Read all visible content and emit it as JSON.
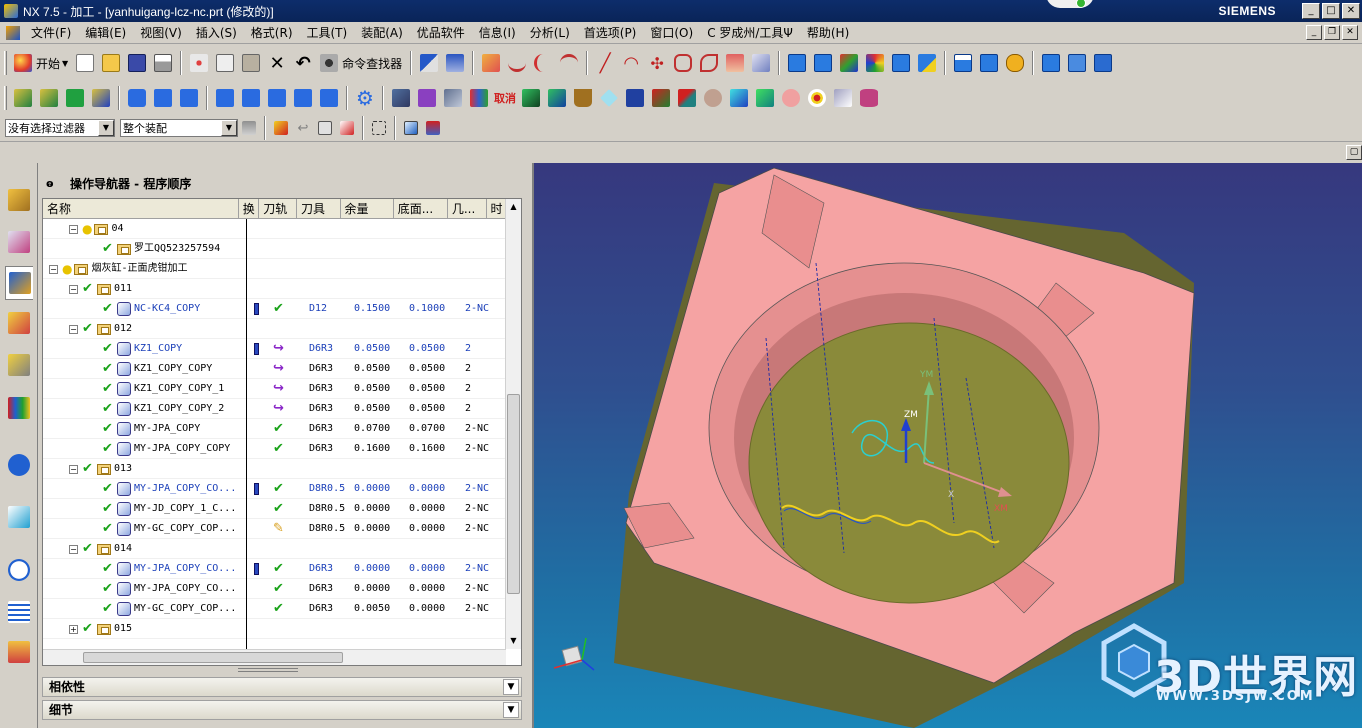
{
  "window": {
    "title": "NX 7.5 - 加工 - [yanhuigang-lcz-nc.prt (修改的)]",
    "brand": "SIEMENS",
    "controls": [
      "_",
      "□",
      "✕"
    ]
  },
  "menubar": {
    "items": [
      "文件(F)",
      "编辑(E)",
      "视图(V)",
      "插入(S)",
      "格式(R)",
      "工具(T)",
      "装配(A)",
      "优品软件",
      "信息(I)",
      "分析(L)",
      "首选项(P)",
      "窗口(O)",
      "C 罗成州/工具Ψ",
      "帮助(H)"
    ]
  },
  "toolbar": {
    "start_label": "开始",
    "finder_label": "命令查找器",
    "filter_select": "没有选择过滤器",
    "assembly_select": "整个装配"
  },
  "navigator": {
    "title": "操作导航器 - 程序顺序",
    "columns": [
      "名称",
      "换",
      "刀轨",
      "刀具",
      "余量",
      "底面...",
      "几...",
      "时"
    ],
    "rows": [
      {
        "indent": 1,
        "expander": "−",
        "bulb": true,
        "check": false,
        "icon": "folder",
        "name": "04",
        "lock": false,
        "status": "",
        "tool": "",
        "stock": "",
        "floor": "",
        "geom": "",
        "blue": false
      },
      {
        "indent": 2,
        "expander": "",
        "bulb": false,
        "check": true,
        "icon": "folder",
        "name": "罗工QQ523257594",
        "lock": false,
        "status": "",
        "tool": "",
        "stock": "",
        "floor": "",
        "geom": "",
        "blue": false
      },
      {
        "indent": 0,
        "expander": "−",
        "bulb": true,
        "check": false,
        "icon": "folder",
        "name": "烟灰缸-正面虎钳加工",
        "lock": false,
        "status": "",
        "tool": "",
        "stock": "",
        "floor": "",
        "geom": "",
        "blue": false
      },
      {
        "indent": 1,
        "expander": "−",
        "bulb": false,
        "check": true,
        "icon": "folder",
        "name": "011",
        "lock": false,
        "status": "",
        "tool": "",
        "stock": "",
        "floor": "",
        "geom": "",
        "blue": false
      },
      {
        "indent": 2,
        "expander": "",
        "bulb": false,
        "check": true,
        "icon": "op",
        "name": "NC-KC4_COPY",
        "lock": true,
        "status": "ok",
        "tool": "D12",
        "stock": "0.1500",
        "floor": "0.1000",
        "geom": "2-NC",
        "blue": true
      },
      {
        "indent": 1,
        "expander": "−",
        "bulb": false,
        "check": true,
        "icon": "folder",
        "name": "012",
        "lock": false,
        "status": "",
        "tool": "",
        "stock": "",
        "floor": "",
        "geom": "",
        "blue": false
      },
      {
        "indent": 2,
        "expander": "",
        "bulb": false,
        "check": true,
        "icon": "op",
        "name": "KZ1_COPY",
        "lock": true,
        "status": "regen",
        "tool": "D6R3",
        "stock": "0.0500",
        "floor": "0.0500",
        "geom": "2",
        "blue": true
      },
      {
        "indent": 2,
        "expander": "",
        "bulb": false,
        "check": true,
        "icon": "op",
        "name": "KZ1_COPY_COPY",
        "lock": false,
        "status": "regen",
        "tool": "D6R3",
        "stock": "0.0500",
        "floor": "0.0500",
        "geom": "2",
        "blue": false
      },
      {
        "indent": 2,
        "expander": "",
        "bulb": false,
        "check": true,
        "icon": "op",
        "name": "KZ1_COPY_COPY_1",
        "lock": false,
        "status": "regen",
        "tool": "D6R3",
        "stock": "0.0500",
        "floor": "0.0500",
        "geom": "2",
        "blue": false
      },
      {
        "indent": 2,
        "expander": "",
        "bulb": false,
        "check": true,
        "icon": "op",
        "name": "KZ1_COPY_COPY_2",
        "lock": false,
        "status": "regen",
        "tool": "D6R3",
        "stock": "0.0500",
        "floor": "0.0500",
        "geom": "2",
        "blue": false
      },
      {
        "indent": 2,
        "expander": "",
        "bulb": false,
        "check": true,
        "icon": "op",
        "name": "MY-JPA_COPY",
        "lock": false,
        "status": "ok",
        "tool": "D6R3",
        "stock": "0.0700",
        "floor": "0.0700",
        "geom": "2-NC",
        "blue": false
      },
      {
        "indent": 2,
        "expander": "",
        "bulb": false,
        "check": true,
        "icon": "op",
        "name": "MY-JPA_COPY_COPY",
        "lock": false,
        "status": "ok",
        "tool": "D6R3",
        "stock": "0.1600",
        "floor": "0.1600",
        "geom": "2-NC",
        "blue": false
      },
      {
        "indent": 1,
        "expander": "−",
        "bulb": false,
        "check": true,
        "icon": "folder",
        "name": "013",
        "lock": false,
        "status": "",
        "tool": "",
        "stock": "",
        "floor": "",
        "geom": "",
        "blue": false
      },
      {
        "indent": 2,
        "expander": "",
        "bulb": false,
        "check": true,
        "icon": "op",
        "name": "MY-JPA_COPY_CO...",
        "lock": true,
        "status": "ok",
        "tool": "D8R0.5",
        "stock": "0.0000",
        "floor": "0.0000",
        "geom": "2-NC",
        "blue": true
      },
      {
        "indent": 2,
        "expander": "",
        "bulb": false,
        "check": true,
        "icon": "op",
        "name": "MY-JD_COPY_1_C...",
        "lock": false,
        "status": "ok",
        "tool": "D8R0.5",
        "stock": "0.0000",
        "floor": "0.0000",
        "geom": "2-NC",
        "blue": false
      },
      {
        "indent": 2,
        "expander": "",
        "bulb": false,
        "check": true,
        "icon": "op",
        "name": "MY-GC_COPY_COP...",
        "lock": false,
        "status": "wrench",
        "tool": "D8R0.5",
        "stock": "0.0000",
        "floor": "0.0000",
        "geom": "2-NC",
        "blue": false
      },
      {
        "indent": 1,
        "expander": "−",
        "bulb": false,
        "check": true,
        "icon": "folder",
        "name": "014",
        "lock": false,
        "status": "",
        "tool": "",
        "stock": "",
        "floor": "",
        "geom": "",
        "blue": false
      },
      {
        "indent": 2,
        "expander": "",
        "bulb": false,
        "check": true,
        "icon": "op",
        "name": "MY-JPA_COPY_CO...",
        "lock": true,
        "status": "ok",
        "tool": "D6R3",
        "stock": "0.0000",
        "floor": "0.0000",
        "geom": "2-NC",
        "blue": true
      },
      {
        "indent": 2,
        "expander": "",
        "bulb": false,
        "check": true,
        "icon": "op",
        "name": "MY-JPA_COPY_CO...",
        "lock": false,
        "status": "ok",
        "tool": "D6R3",
        "stock": "0.0000",
        "floor": "0.0000",
        "geom": "2-NC",
        "blue": false
      },
      {
        "indent": 2,
        "expander": "",
        "bulb": false,
        "check": true,
        "icon": "op",
        "name": "MY-GC_COPY_COP...",
        "lock": false,
        "status": "ok",
        "tool": "D6R3",
        "stock": "0.0050",
        "floor": "0.0000",
        "geom": "2-NC",
        "blue": false
      },
      {
        "indent": 1,
        "expander": "+",
        "bulb": false,
        "check": true,
        "icon": "folder",
        "name": "015",
        "lock": false,
        "status": "",
        "tool": "",
        "stock": "",
        "floor": "",
        "geom": "",
        "blue": false
      }
    ],
    "panels": [
      "相依性",
      "细节"
    ]
  },
  "viewport": {
    "axis_labels": [
      "YM",
      "ZM",
      "XM",
      "X"
    ],
    "watermark": "3D世界网",
    "watermark_url": "WWW.3DSJW.COM"
  },
  "colors": {
    "part_top": "#f5a3a3",
    "part_side": "#656530",
    "pocket_floor": "#8a8a3a",
    "viewport_top": "#36387e",
    "viewport_bottom": "#1a86b8"
  },
  "icons": {
    "toolbar1": [
      "new-file-icon",
      "open-file-icon",
      "save-icon",
      "print-icon",
      "cut-icon",
      "copy-icon",
      "paste-icon",
      "delete-icon",
      "undo-icon",
      "command-finder-icon",
      "snap-icon",
      "select-icon",
      "sketch-icon",
      "curve-icon",
      "spline-icon",
      "offset-curve-icon",
      "line-icon",
      "arc-icon",
      "point-icon",
      "extrude-icon",
      "revolve-icon",
      "hole-icon",
      "feature-icon",
      "up-icon",
      "down-icon",
      "color-icon",
      "swap-icon",
      "shade-icon",
      "tag-icon",
      "layer-icon",
      "toggle-icon",
      "pin-icon",
      "abs-icon",
      "abs2-icon",
      "abs3-icon"
    ],
    "toolbar2": [
      "view-top-icon",
      "view-front-icon",
      "view-iso-icon",
      "view-right-icon",
      "info-icon",
      "layout-icon",
      "layout2-icon",
      "mesh-icon",
      "barcode-icon",
      "grid-icon",
      "columns-icon",
      "rotate-icon",
      "gear-icon",
      "cube-dark-icon",
      "cube-purple-icon",
      "blocks-icon",
      "library-icon",
      "cancel-text-icon",
      "box-green-icon",
      "box-blue-icon",
      "pot-icon",
      "diamond-icon",
      "square-blue-icon",
      "box-red-icon",
      "stripes-icon",
      "face-icon",
      "cube-cyan-icon",
      "cube-teal-icon",
      "pig-icon",
      "target-icon",
      "tools-icon",
      "cylinder-icon"
    ],
    "toolbar3": [
      "funnel-icon",
      "snap-point-icon",
      "back-icon",
      "cursor-icon",
      "cursor2-icon",
      "select-box-icon",
      "cube-select-icon",
      "pin-red-icon"
    ]
  }
}
